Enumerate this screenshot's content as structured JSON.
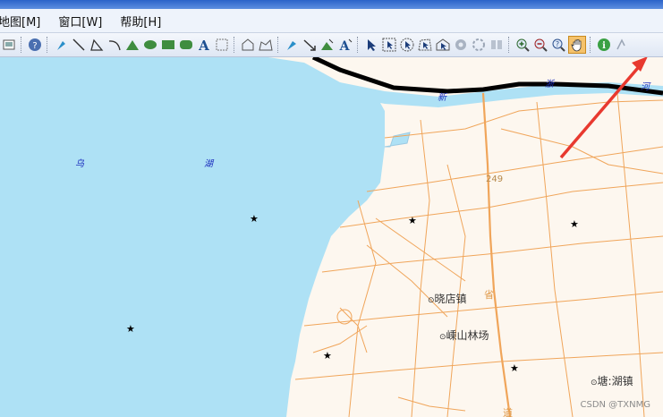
{
  "menu": {
    "items": [
      "地图[M]",
      "窗口[W]",
      "帮助[H]"
    ]
  },
  "toolbar": {
    "icons": [
      "map-icon",
      "help-icon",
      "pin-icon",
      "line-icon",
      "polyline-icon",
      "arc-icon",
      "mountain-icon",
      "ellipse-icon",
      "rectangle-icon",
      "rounded-rect-icon",
      "text-icon",
      "frame-icon",
      "polygon-icon",
      "region-icon",
      "edit-pin-icon",
      "edit-line-icon",
      "edit-mountain-icon",
      "edit-text-icon",
      "pointer-icon",
      "select-box-icon",
      "select-radius-icon",
      "select-polygon-icon",
      "select-region-icon",
      "gear-icon",
      "toggle-icon",
      "snap-icon",
      "zoom-in-icon",
      "zoom-out-icon",
      "search-zoom-icon",
      "hand-pan-icon",
      "info-icon",
      "layers-icon"
    ]
  },
  "map": {
    "labels": {
      "lake_wu": "乌",
      "lake_hu": "湖",
      "road_249": "249",
      "river_1": "新",
      "river_2": "浙",
      "river_3": "河",
      "town_xiaodian": "晓店镇",
      "town_shanlin": "嵊山林场",
      "town_tanghu": "塘:湖镇",
      "char_sheng": "省",
      "char_dao": "道"
    },
    "watermark": "CSDN @TXNMG"
  },
  "colors": {
    "lake": "#aee1f5",
    "land": "#fdf7ef",
    "road": "#f0a55a",
    "arrow": "#e8392f"
  }
}
